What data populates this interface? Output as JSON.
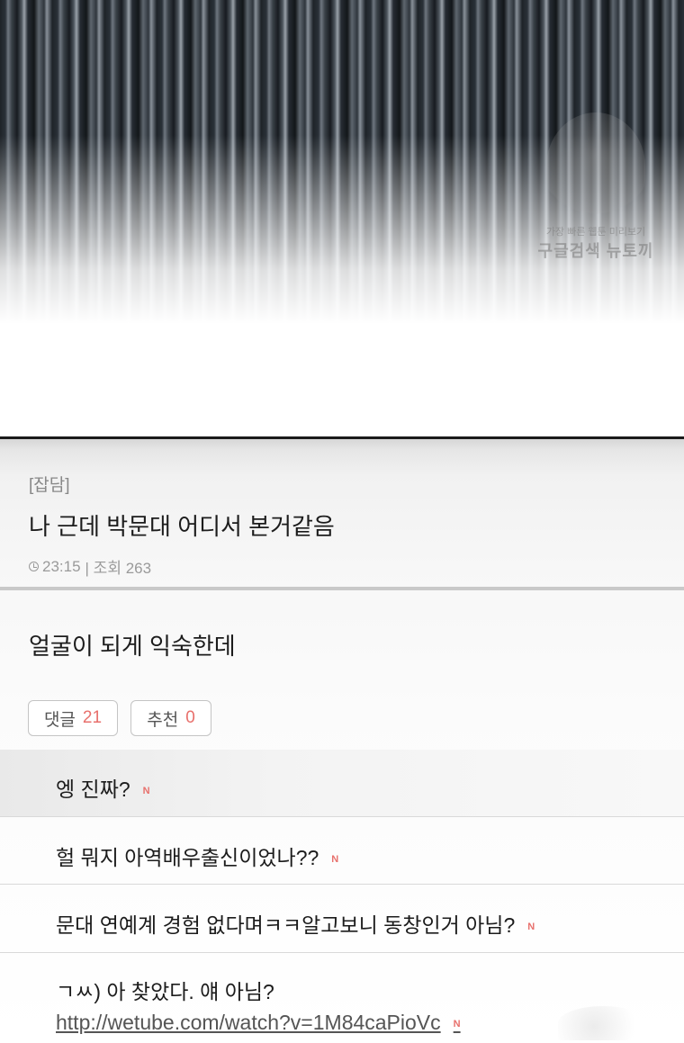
{
  "watermark": {
    "line1": "가장 빠른 웹툰 미리보기",
    "line2": "구글검색 뉴토끼"
  },
  "post": {
    "category": "[잡담]",
    "title": "나 근데 박문대 어디서 본거같음",
    "time": "23:15",
    "views_label": "| 조회 263",
    "body": "얼굴이 되게 익숙한데",
    "comments_button_label": "댓글",
    "comments_count": "21",
    "recommend_button_label": "추천",
    "recommend_count": "0"
  },
  "comments": [
    {
      "text": "엥 진짜?",
      "badge": "N"
    },
    {
      "text": "헐 뭐지 아역배우출신이었나??",
      "badge": "N"
    },
    {
      "text": "문대 연예계 경험 없다며ㅋㅋ알고보니 동창인거 아님?",
      "badge": "N"
    },
    {
      "text": "ㄱㅆ) 아 찾았다. 얘 아님?",
      "link": "http://wetube.com/watch?v=1M84caPioVc",
      "badge": "N"
    }
  ],
  "colors": {
    "accent": "#e8706c",
    "divider": "#c9c9c9"
  }
}
